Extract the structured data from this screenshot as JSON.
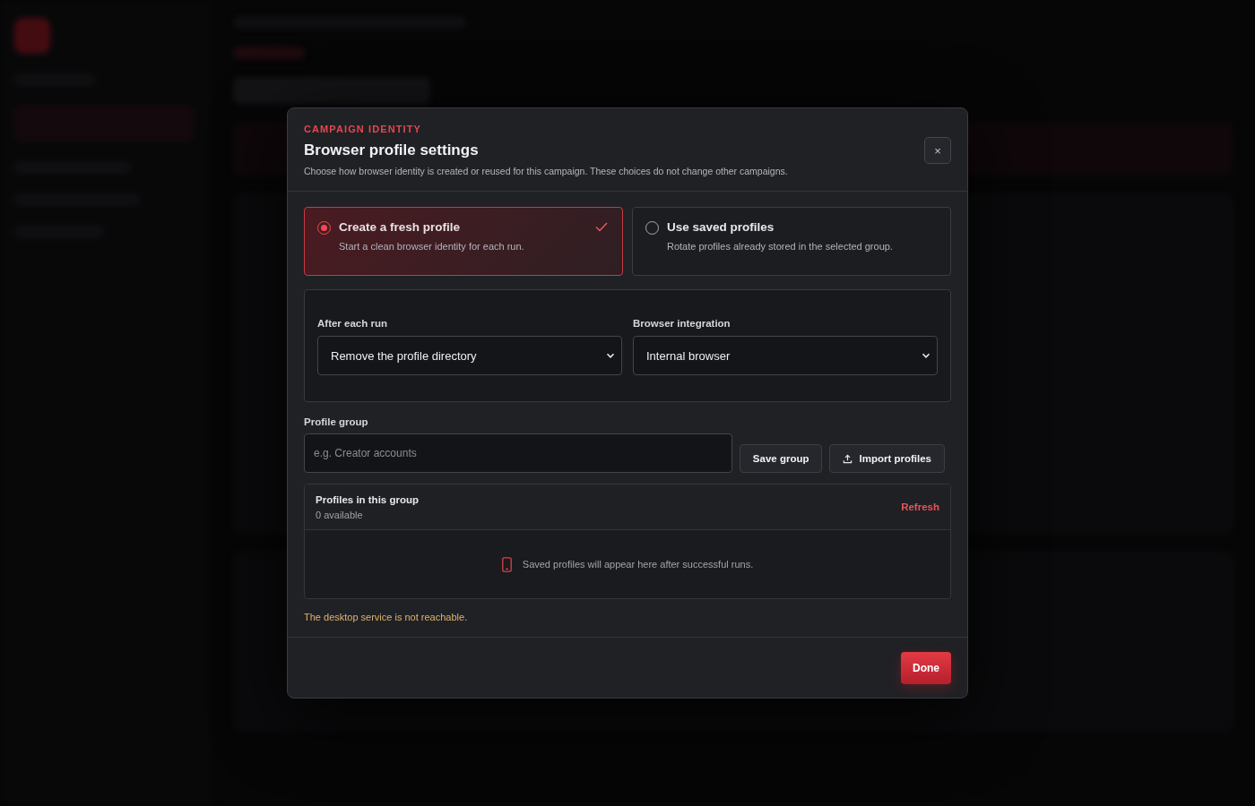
{
  "dialog": {
    "eyebrow": "CAMPAIGN IDENTITY",
    "title": "Browser profile settings",
    "description": "Choose how browser identity is created or reused for this campaign. These choices do not change other campaigns.",
    "close_label": "×"
  },
  "modes": [
    {
      "title": "Create a fresh profile",
      "description": "Start a clean browser identity for each run.",
      "selected": true
    },
    {
      "title": "Use saved profiles",
      "description": "Rotate profiles already stored in the selected group.",
      "selected": false
    }
  ],
  "selects": [
    {
      "label": "After each run",
      "value": "Remove the profile directory"
    },
    {
      "label": "Browser integration",
      "value": "Internal browser"
    }
  ],
  "profile_group": {
    "label": "Profile group",
    "placeholder": "e.g. Creator accounts",
    "buttons": [
      {
        "label": "Save group",
        "kind": "plain"
      },
      {
        "label": "Import profiles",
        "kind": "upload"
      }
    ]
  },
  "profiles_panel": {
    "title": "Profiles in this group",
    "count": "0 available",
    "action": "Refresh",
    "empty_message": "Saved profiles will appear here after successful runs."
  },
  "warning": "The desktop service is not reachable.",
  "done_label": "Done"
}
